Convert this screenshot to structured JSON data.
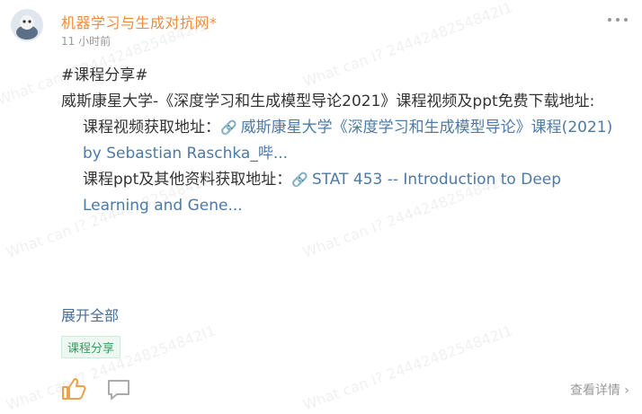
{
  "post": {
    "author": "机器学习与生成对抗网*",
    "time": "11 小时前",
    "hashtag": "#课程分享#",
    "title": "威斯康星大学-《深度学习和生成模型导论2021》课程视频及ppt免费下载地址:",
    "video_label": "课程视频获取地址：",
    "video_link": "威斯康星大学《深度学习和生成模型导论》课程(2021) by Sebastian Raschka_哔...",
    "ppt_label": "课程ppt及其他资料获取地址：",
    "ppt_link": "STAT 453 -- Introduction to Deep Learning and Gene...",
    "expand_label": "展开全部",
    "tag": "课程分享",
    "detail_label": "查看详情 ›"
  },
  "watermark": "What can I? 2444248254842I1",
  "icons": [
    "avatar-image",
    "more-icon",
    "link-icon",
    "like-icon",
    "comment-icon"
  ],
  "colors": {
    "author": "#f08a3c",
    "link": "#4d7aa6",
    "tag": "#3a9c62"
  }
}
